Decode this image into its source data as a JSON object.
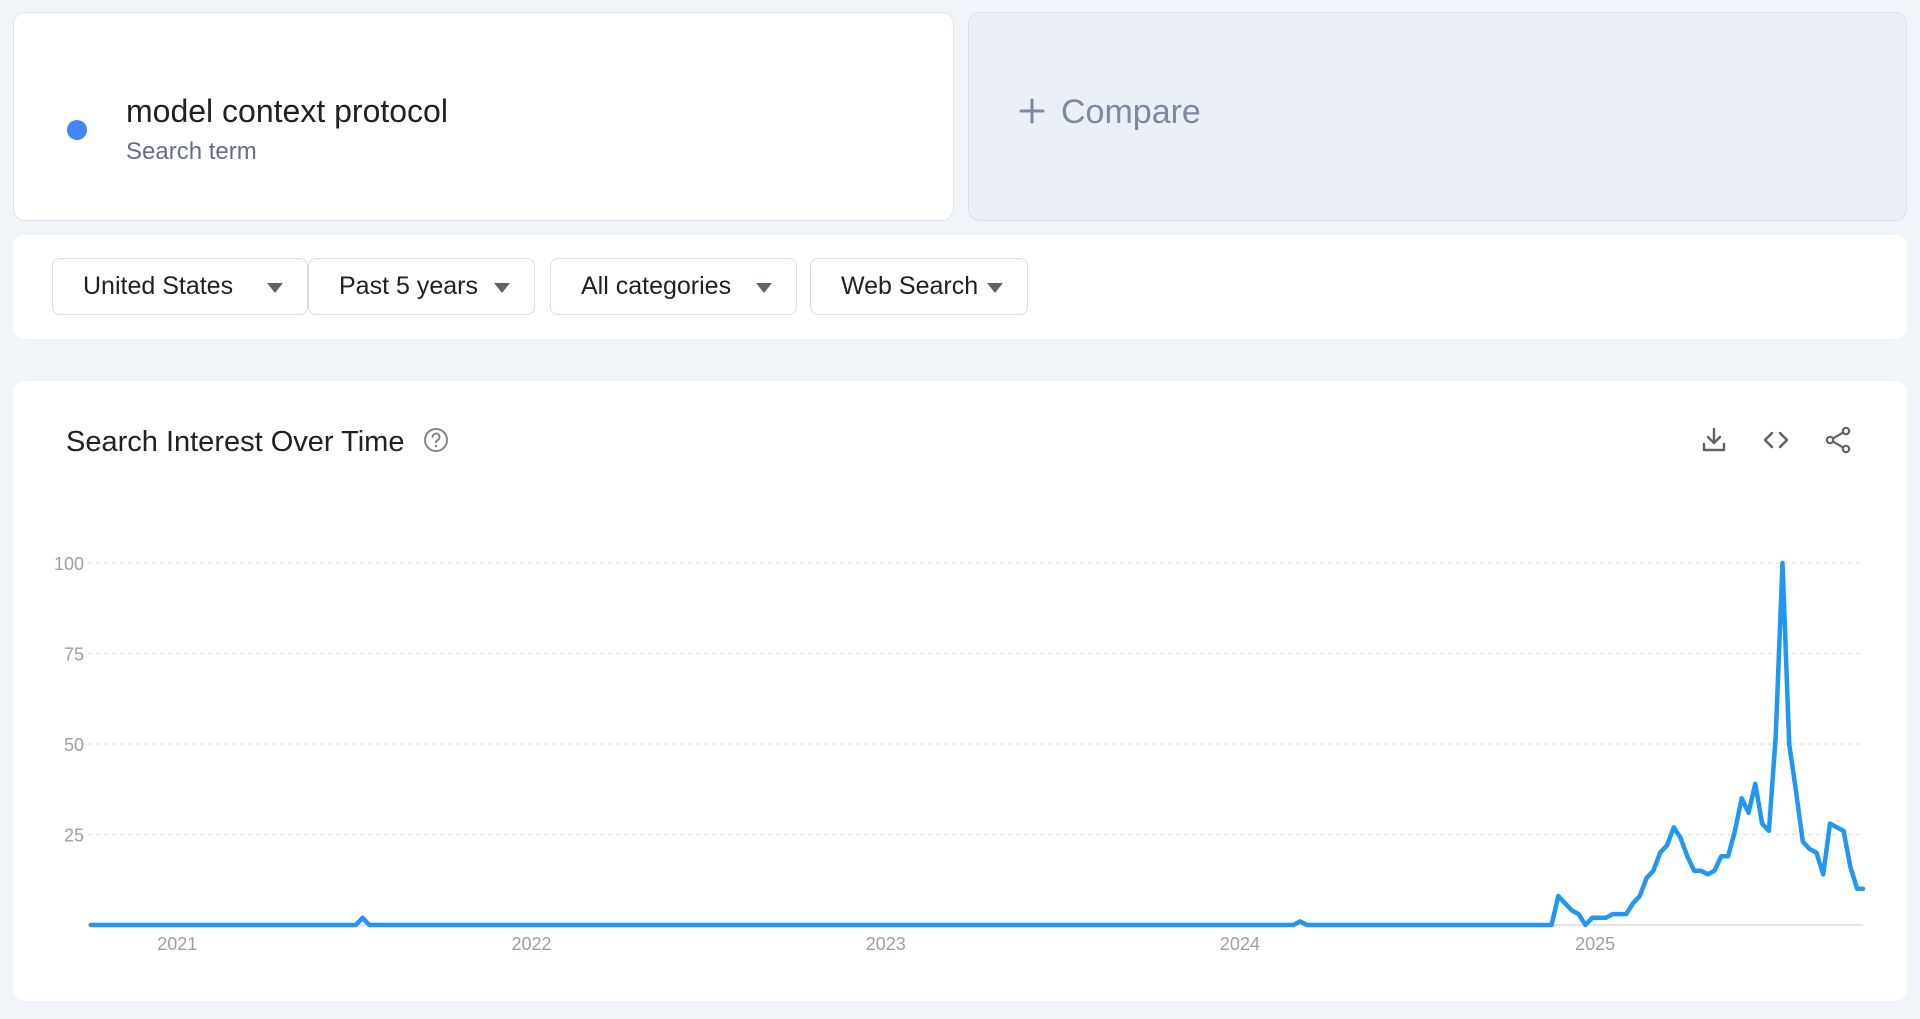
{
  "term": {
    "title": "model context protocol",
    "subtitle": "Search term",
    "dot_color": "#4285f4"
  },
  "compare": {
    "label": "Compare",
    "icon": "plus-icon"
  },
  "filters": [
    {
      "label": "United States",
      "icon": "caret-down-icon"
    },
    {
      "label": "Past 5 years",
      "icon": "caret-down-icon"
    },
    {
      "label": "All categories",
      "icon": "caret-down-icon"
    },
    {
      "label": "Web Search",
      "icon": "caret-down-icon"
    }
  ],
  "chart_header": {
    "title": "Search Interest Over Time",
    "help_icon": "help-circle-icon",
    "actions": [
      "download-icon",
      "embed-code-icon",
      "share-icon"
    ]
  },
  "colors": {
    "series": "#2196f3",
    "grid": "#e3e6ea",
    "axis": "#dadce0",
    "tick_text": "#9aa0a6"
  },
  "chart_data": {
    "type": "line",
    "ylim": [
      0,
      100
    ],
    "yticks": [
      25,
      50,
      75,
      100
    ],
    "xlim": [
      "2020-10-01",
      "2025-10-04"
    ],
    "xticks": [
      "2021",
      "2022",
      "2023",
      "2024",
      "2025"
    ],
    "grid": true,
    "legend": "none",
    "series": [
      {
        "name": "model context protocol",
        "x": [
          "2020-10-04",
          "2021-07-04",
          "2021-07-11",
          "2021-07-18",
          "2024-02-25",
          "2024-03-03",
          "2024-03-10",
          "2024-11-17",
          "2024-11-24",
          "2024-12-01",
          "2024-12-08",
          "2024-12-15",
          "2024-12-22",
          "2024-12-29",
          "2025-01-05",
          "2025-01-12",
          "2025-01-19",
          "2025-01-26",
          "2025-02-02",
          "2025-02-09",
          "2025-02-16",
          "2025-02-23",
          "2025-03-02",
          "2025-03-09",
          "2025-03-16",
          "2025-03-23",
          "2025-03-30",
          "2025-04-06",
          "2025-04-13",
          "2025-04-20",
          "2025-04-27",
          "2025-05-04",
          "2025-05-11",
          "2025-05-18",
          "2025-05-25",
          "2025-06-01",
          "2025-06-08",
          "2025-06-15",
          "2025-06-22",
          "2025-06-29",
          "2025-07-06",
          "2025-07-13",
          "2025-07-20",
          "2025-07-27",
          "2025-08-03",
          "2025-08-10",
          "2025-08-17",
          "2025-08-24",
          "2025-08-31",
          "2025-09-07",
          "2025-09-14",
          "2025-09-21",
          "2025-09-28"
        ],
        "values": [
          0,
          0,
          2,
          0,
          0,
          1,
          0,
          0,
          8,
          6,
          4,
          3,
          0,
          2,
          2,
          2,
          3,
          3,
          3,
          6,
          8,
          13,
          15,
          20,
          22,
          27,
          24,
          19,
          15,
          15,
          14,
          15,
          19,
          19,
          26,
          35,
          31,
          39,
          28,
          26,
          52,
          100,
          50,
          37,
          23,
          21,
          20,
          14,
          28,
          27,
          26,
          16,
          10
        ]
      }
    ]
  }
}
